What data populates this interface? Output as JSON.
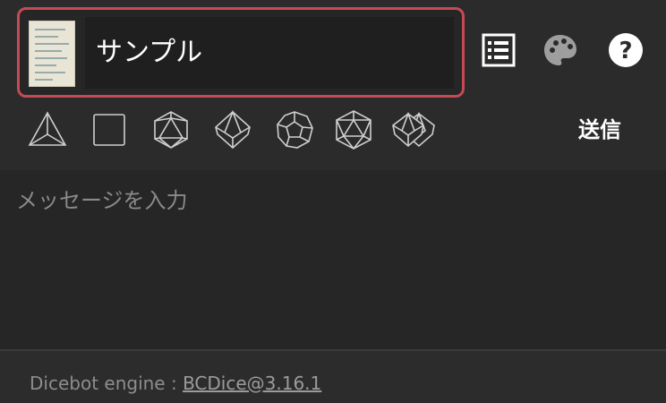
{
  "character": {
    "name": "サンプル",
    "thumbnail_icon": "character-sheet-thumbnail"
  },
  "toolbar": {
    "icons": [
      "list-icon",
      "palette-icon",
      "help-icon"
    ]
  },
  "dice": [
    "d4-icon",
    "d6-icon",
    "d8-icon",
    "d10-icon",
    "d12-icon",
    "d20-icon",
    "d100-icon"
  ],
  "send": {
    "label": "送信"
  },
  "message": {
    "placeholder": "メッセージを入力"
  },
  "footer": {
    "prefix": "Dicebot engine :",
    "engine_link": "BCDice@3.16.1"
  },
  "colors": {
    "accent": "#c64a55",
    "background": "#2b2b2b",
    "input_background": "#1f1f1f"
  }
}
